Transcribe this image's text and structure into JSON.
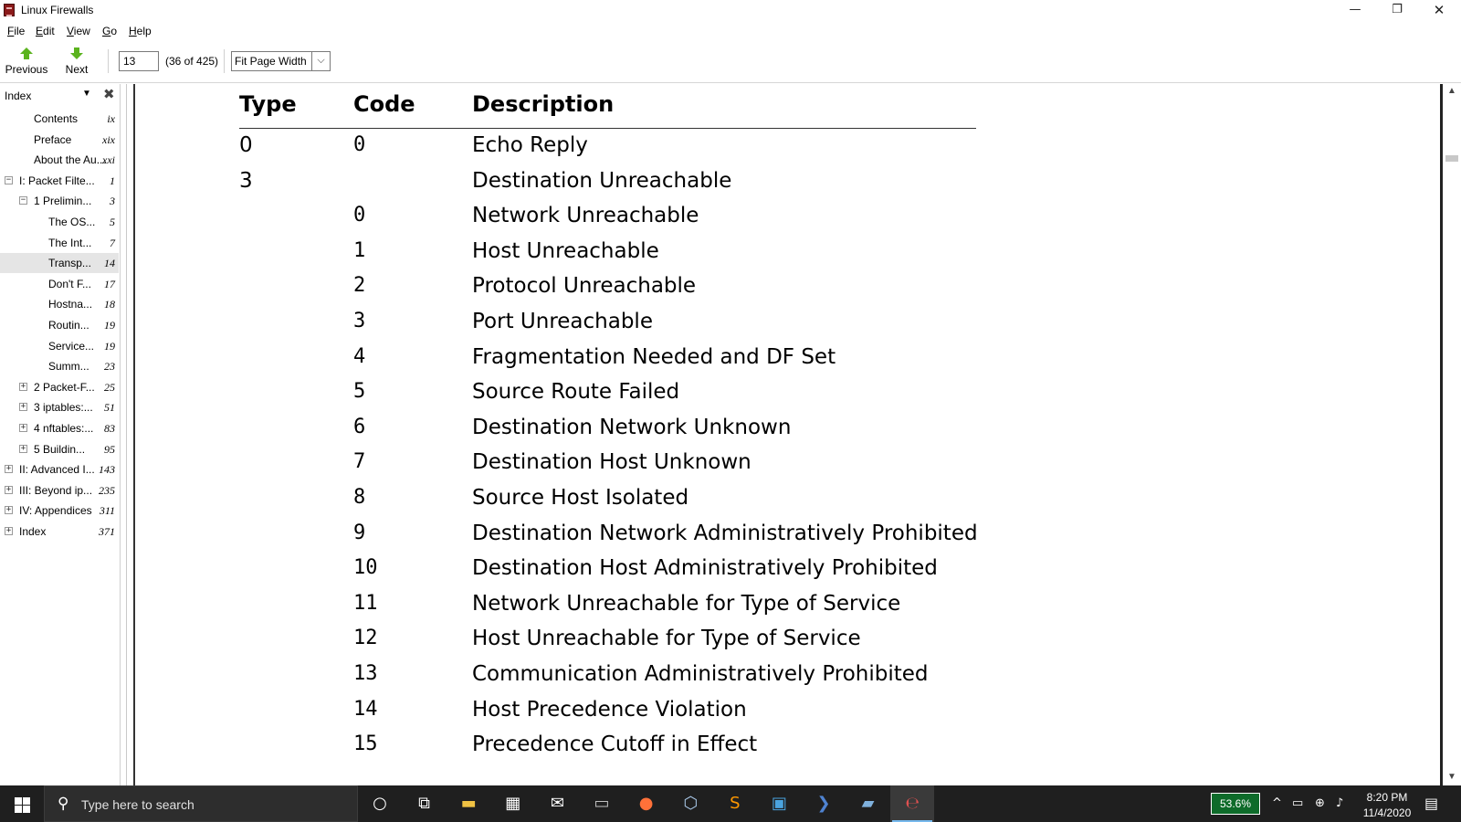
{
  "window": {
    "title": "Linux Firewalls",
    "min_glyph": "—",
    "max_glyph": "❐",
    "close_glyph": "✕"
  },
  "menu": [
    {
      "first": "F",
      "rest": "ile"
    },
    {
      "first": "E",
      "rest": "dit"
    },
    {
      "first": "V",
      "rest": "iew"
    },
    {
      "first": "G",
      "rest": "o"
    },
    {
      "first": "H",
      "rest": "elp"
    }
  ],
  "toolbar": {
    "previous_label": "Previous",
    "next_label": "Next",
    "page_value": "13",
    "page_count": "(36 of 425)",
    "zoom_value": "Fit Page Width",
    "zoom_arrow": "⌵",
    "arrow_color": "#5bb31e"
  },
  "sidebar": {
    "title": "Index",
    "dropdown_glyph": "▼",
    "close_glyph": "✖",
    "items": [
      {
        "label": "Contents",
        "page": "ix",
        "level": 1,
        "expander": ""
      },
      {
        "label": "Preface",
        "page": "xix",
        "level": 1,
        "expander": ""
      },
      {
        "label": "About the Au...",
        "page": "xxi",
        "level": 1,
        "expander": ""
      },
      {
        "label": "I: Packet Filte...",
        "page": "1",
        "level": 0,
        "expander": "−"
      },
      {
        "label": "1 Prelimin...",
        "page": "3",
        "level": 1,
        "expander": "−"
      },
      {
        "label": "The OS...",
        "page": "5",
        "level": 2,
        "expander": ""
      },
      {
        "label": "The Int...",
        "page": "7",
        "level": 2,
        "expander": ""
      },
      {
        "label": "Transp...",
        "page": "14",
        "level": 2,
        "expander": "",
        "selected": true
      },
      {
        "label": "Don't F...",
        "page": "17",
        "level": 2,
        "expander": ""
      },
      {
        "label": "Hostna...",
        "page": "18",
        "level": 2,
        "expander": ""
      },
      {
        "label": "Routin...",
        "page": "19",
        "level": 2,
        "expander": ""
      },
      {
        "label": "Service...",
        "page": "19",
        "level": 2,
        "expander": ""
      },
      {
        "label": "Summ...",
        "page": "23",
        "level": 2,
        "expander": ""
      },
      {
        "label": "2 Packet-F...",
        "page": "25",
        "level": 1,
        "expander": "+"
      },
      {
        "label": "3 iptables:...",
        "page": "51",
        "level": 1,
        "expander": "+"
      },
      {
        "label": "4 nftables:...",
        "page": "83",
        "level": 1,
        "expander": "+"
      },
      {
        "label": "5 Buildin...",
        "page": "95",
        "level": 1,
        "expander": "+"
      },
      {
        "label": "II: Advanced I...",
        "page": "143",
        "level": 0,
        "expander": "+"
      },
      {
        "label": "III: Beyond ip...",
        "page": "235",
        "level": 0,
        "expander": "+"
      },
      {
        "label": "IV: Appendices",
        "page": "311",
        "level": 0,
        "expander": "+"
      },
      {
        "label": "Index",
        "page": "371",
        "level": 0,
        "expander": "+"
      }
    ]
  },
  "table": {
    "headers": {
      "type": "Type",
      "code": "Code",
      "description": "Description"
    },
    "rows": [
      {
        "type": "0",
        "code": "0",
        "description": "Echo Reply"
      },
      {
        "type": "3",
        "code": "",
        "description": "Destination Unreachable"
      },
      {
        "type": "",
        "code": "0",
        "description": "Network Unreachable"
      },
      {
        "type": "",
        "code": "1",
        "description": "Host Unreachable"
      },
      {
        "type": "",
        "code": "2",
        "description": "Protocol Unreachable"
      },
      {
        "type": "",
        "code": "3",
        "description": "Port Unreachable"
      },
      {
        "type": "",
        "code": "4",
        "description": "Fragmentation Needed and DF Set"
      },
      {
        "type": "",
        "code": "5",
        "description": "Source Route Failed"
      },
      {
        "type": "",
        "code": "6",
        "description": "Destination Network Unknown"
      },
      {
        "type": "",
        "code": "7",
        "description": "Destination Host Unknown"
      },
      {
        "type": "",
        "code": "8",
        "description": "Source Host Isolated"
      },
      {
        "type": "",
        "code": "9",
        "description": "Destination Network Administratively Prohibited"
      },
      {
        "type": "",
        "code": "10",
        "description": "Destination Host Administratively Prohibited"
      },
      {
        "type": "",
        "code": "11",
        "description": "Network Unreachable for Type of Service"
      },
      {
        "type": "",
        "code": "12",
        "description": "Host Unreachable for Type of Service"
      },
      {
        "type": "",
        "code": "13",
        "description": "Communication Administratively Prohibited"
      },
      {
        "type": "",
        "code": "14",
        "description": "Host Precedence Violation"
      },
      {
        "type": "",
        "code": "15",
        "description": "Precedence Cutoff in Effect"
      }
    ]
  },
  "scrollbar": {
    "up_glyph": "▲",
    "down_glyph": "▼"
  },
  "taskbar": {
    "search_placeholder": "Type here to search",
    "search_glyph": "⚲",
    "apps": [
      {
        "name": "cortana-icon",
        "glyph": "○",
        "color": "#ffffff"
      },
      {
        "name": "task-view-icon",
        "glyph": "⧉",
        "color": "#ffffff"
      },
      {
        "name": "file-explorer-icon",
        "glyph": "▬",
        "color": "#f0c243"
      },
      {
        "name": "store-icon",
        "glyph": "▦",
        "color": "#ffffff"
      },
      {
        "name": "mail-icon",
        "glyph": "✉",
        "color": "#ffffff"
      },
      {
        "name": "terminal-icon",
        "glyph": "▭",
        "color": "#c0c0c0"
      },
      {
        "name": "firefox-icon",
        "glyph": "●",
        "color": "#ff7139"
      },
      {
        "name": "virtualbox-icon",
        "glyph": "⬡",
        "color": "#a9c8e8"
      },
      {
        "name": "sublime-icon",
        "glyph": "S",
        "color": "#ff9800"
      },
      {
        "name": "remote-desktop-icon",
        "glyph": "▣",
        "color": "#4aa3df"
      },
      {
        "name": "powershell-icon",
        "glyph": "❯",
        "color": "#4f83d1"
      },
      {
        "name": "vmware-icon",
        "glyph": "▰",
        "color": "#7fb1dd"
      },
      {
        "name": "ebook-reader-icon",
        "glyph": "℮",
        "color": "#e05050"
      }
    ],
    "battery_text": "53.6%",
    "tray": [
      {
        "name": "tray-chevron-icon",
        "glyph": "^"
      },
      {
        "name": "battery-icon",
        "glyph": "▭"
      },
      {
        "name": "network-icon",
        "glyph": "⊕"
      },
      {
        "name": "volume-icon",
        "glyph": "♪"
      }
    ],
    "time": "8:20 PM",
    "date": "11/4/2020",
    "notification_glyph": "▤"
  }
}
